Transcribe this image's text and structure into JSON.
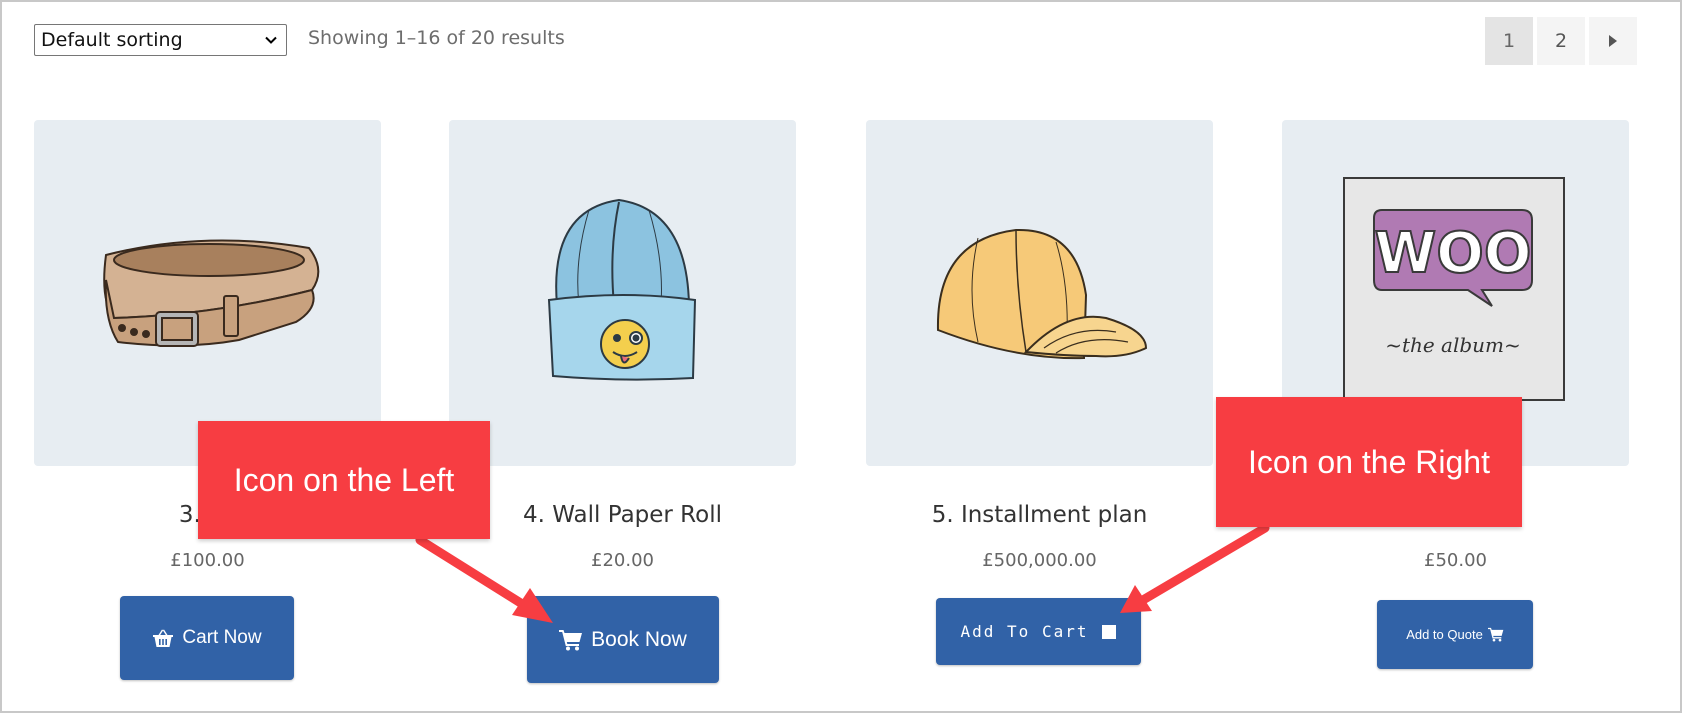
{
  "toolbar": {
    "sort_selected": "Default sorting",
    "result_count": "Showing 1–16 of 20 results"
  },
  "pagination": {
    "pages": [
      "1",
      "2"
    ],
    "current": "1",
    "next_icon": "caret-right-icon"
  },
  "products": [
    {
      "title": "3. Vo",
      "price": "£100.00",
      "button_label": "Cart Now",
      "button_icon": "basket-icon",
      "image": "belt"
    },
    {
      "title": "4. Wall Paper Roll",
      "price": "£20.00",
      "button_label": "Book Now",
      "button_icon": "cart-icon",
      "image": "beanie"
    },
    {
      "title": "5. Installment plan",
      "price": "£500,000.00",
      "button_label": "Add To Cart",
      "button_icon": "square-icon",
      "image": "cap"
    },
    {
      "title": "",
      "price": "£50.00",
      "button_label": "Add to Quote",
      "button_icon": "cart-icon",
      "image": "woo-album"
    }
  ],
  "album_art": {
    "logo_text": "WOO",
    "subtitle": "~the album~"
  },
  "annotations": {
    "left": "Icon on the Left",
    "right": "Icon on the Right",
    "color": "#f73d42"
  },
  "colors": {
    "button": "#3162a7",
    "thumb_bg": "#e7edf2"
  }
}
